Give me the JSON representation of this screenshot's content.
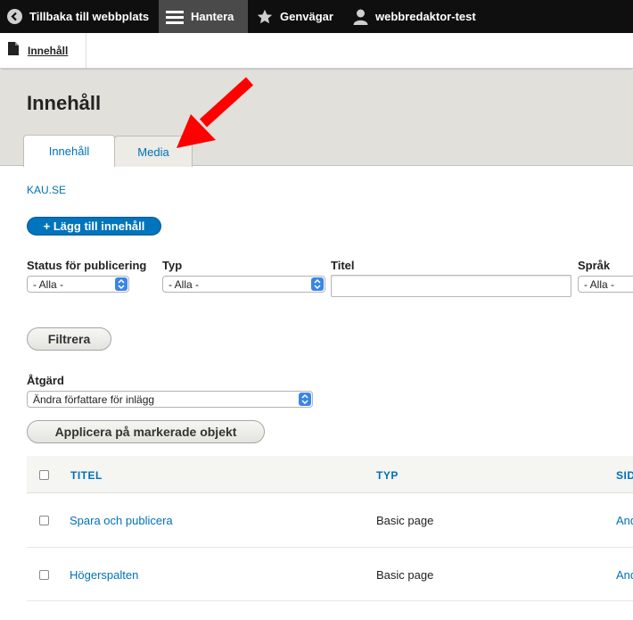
{
  "toolbar": {
    "back": "Tillbaka till webbplats",
    "manage": "Hantera",
    "shortcuts": "Genvägar",
    "user": "webbredaktor-test"
  },
  "tray": {
    "content_link": "Innehåll"
  },
  "header": {
    "title": "Innehåll",
    "tabs": [
      {
        "label": "Innehåll",
        "active": true
      },
      {
        "label": "Media",
        "active": false
      }
    ]
  },
  "site_link": "KAU.SE",
  "add_button": "+ Lägg till innehåll",
  "filters": {
    "status": {
      "label": "Status för publicering",
      "value": "- Alla -"
    },
    "type": {
      "label": "Typ",
      "value": "- Alla -"
    },
    "title": {
      "label": "Titel",
      "value": ""
    },
    "language": {
      "label": "Språk",
      "value": "- Alla -"
    },
    "filter_button": "Filtrera"
  },
  "bulk": {
    "label": "Åtgärd",
    "value": "Ändra författare för inlägg",
    "apply_button": "Applicera på markerade objekt"
  },
  "table": {
    "columns": [
      "TITEL",
      "TYP",
      "SID"
    ],
    "rows": [
      {
        "title": "Spara och publicera",
        "type": "Basic page",
        "col3": "And"
      },
      {
        "title": "Högerspalten",
        "type": "Basic page",
        "col3": "And"
      }
    ]
  },
  "colors": {
    "accent": "#0071b8",
    "button_blue": "#0074bd",
    "arrow": "#ff0000",
    "toolbar": "#0f0f0f"
  }
}
